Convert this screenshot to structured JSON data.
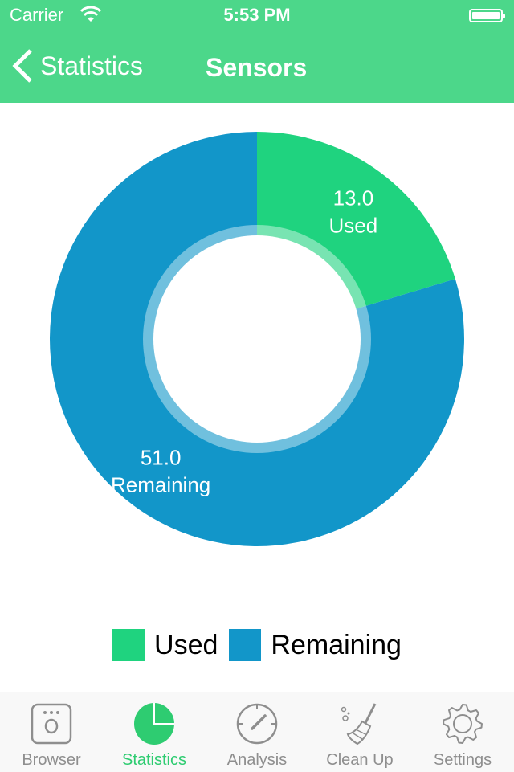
{
  "status_bar": {
    "carrier": "Carrier",
    "time": "5:53 PM",
    "wifi_icon": "wifi-icon",
    "battery_icon": "battery-icon"
  },
  "nav": {
    "back_label": "Statistics",
    "title": "Sensors"
  },
  "colors": {
    "header": "#4cd78a",
    "used": "#1fd37f",
    "remaining": "#1296c9",
    "active_tab": "#2ecc71",
    "inactive_tab": "#8e8e8e"
  },
  "chart_data": {
    "type": "pie",
    "donut": true,
    "categories": [
      "Used",
      "Remaining"
    ],
    "values": [
      13.0,
      51.0
    ],
    "labels": [
      {
        "value": "13.0",
        "name": "Used"
      },
      {
        "value": "51.0",
        "name": "Remaining"
      }
    ],
    "colors": [
      "#1fd37f",
      "#1296c9"
    ],
    "legend": "bottom",
    "legend_entries": [
      "Used",
      "Remaining"
    ]
  },
  "tabs": [
    {
      "label": "Browser",
      "icon": "browser-icon"
    },
    {
      "label": "Statistics",
      "icon": "pie-chart-icon",
      "active": true
    },
    {
      "label": "Analysis",
      "icon": "gauge-icon"
    },
    {
      "label": "Clean Up",
      "icon": "broom-icon"
    },
    {
      "label": "Settings",
      "icon": "gear-icon"
    }
  ]
}
